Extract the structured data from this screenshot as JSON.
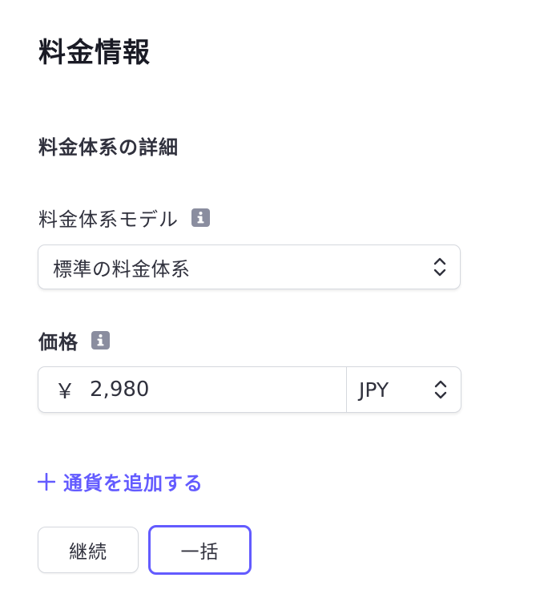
{
  "page": {
    "title": "料金情報",
    "section_title": "料金体系の詳細"
  },
  "pricing_model": {
    "label": "料金体系モデル",
    "selected": "標準の料金体系",
    "info_icon": "info-icon"
  },
  "price": {
    "label": "価格",
    "currency_symbol": "￥",
    "value": "2,980",
    "currency": "JPY",
    "info_icon": "info-icon"
  },
  "add_currency": {
    "label": "通貨を追加する",
    "icon": "plus-icon"
  },
  "billing_type": {
    "options": [
      "継続",
      "一括"
    ],
    "selected": "一括"
  },
  "colors": {
    "accent": "#635bff",
    "text": "#30313d",
    "border": "#d5d8de",
    "icon_gray": "#8a8d9f"
  }
}
